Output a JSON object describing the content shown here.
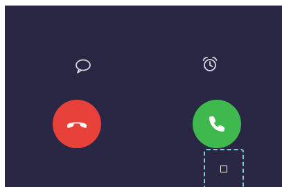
{
  "incoming_call": {
    "message_icon": "speech-bubble-icon",
    "alarm_icon": "alarm-clock-icon",
    "decline_icon": "phone-hangup-icon",
    "accept_icon": "phone-icon",
    "overlay_icon": "square-icon"
  },
  "colors": {
    "background": "#2a2744",
    "decline": "#e8403a",
    "accept": "#3fb84d",
    "icon": "#d8d6e2",
    "highlight": "#7fcfd9"
  }
}
